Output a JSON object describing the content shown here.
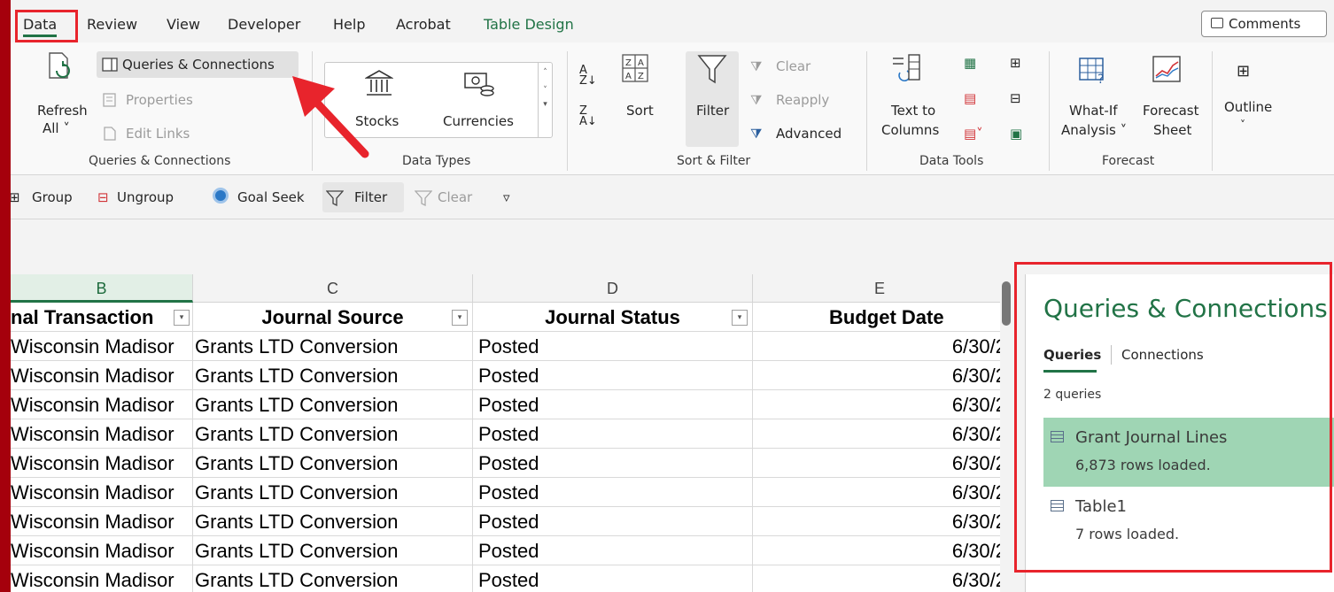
{
  "tabs": [
    {
      "label": "Data"
    },
    {
      "label": "Review"
    },
    {
      "label": "View"
    },
    {
      "label": "Developer"
    },
    {
      "label": "Help"
    },
    {
      "label": "Acrobat"
    },
    {
      "label": "Table Design"
    }
  ],
  "comments_label": "Comments",
  "ribbon": {
    "refresh_label1": "Refresh",
    "refresh_label2": "All ˅",
    "queries_connections": "Queries & Connections",
    "properties": "Properties",
    "edit_links": "Edit Links",
    "group_queries": "Queries & Connections",
    "stocks": "Stocks",
    "currencies": "Currencies",
    "group_datatypes": "Data Types",
    "sort": "Sort",
    "filter": "Filter",
    "clear": "Clear",
    "reapply": "Reapply",
    "advanced": "Advanced",
    "group_sortfilter": "Sort & Filter",
    "text_to1": "Text to",
    "text_to2": "Columns",
    "group_datatools": "Data Tools",
    "whatif1": "What-If",
    "whatif2": "Analysis ˅",
    "forecast1": "Forecast",
    "forecast2": "Sheet",
    "group_forecast": "Forecast",
    "outline": "Outline"
  },
  "qat": {
    "group": "Group",
    "ungroup": "Ungroup",
    "goal_seek": "Goal Seek",
    "filter": "Filter",
    "clear": "Clear"
  },
  "columns": [
    "B",
    "C",
    "D",
    "E"
  ],
  "headers": [
    "nal Transaction",
    "Journal Source",
    "Journal Status",
    "Budget Date"
  ],
  "rows": [
    [
      "Wisconsin Madisor",
      "Grants LTD Conversion",
      "Posted",
      "6/30/2"
    ],
    [
      "Wisconsin Madisor",
      "Grants LTD Conversion",
      "Posted",
      "6/30/2"
    ],
    [
      "Wisconsin Madisor",
      "Grants LTD Conversion",
      "Posted",
      "6/30/2"
    ],
    [
      "Wisconsin Madisor",
      "Grants LTD Conversion",
      "Posted",
      "6/30/2"
    ],
    [
      "Wisconsin Madisor",
      "Grants LTD Conversion",
      "Posted",
      "6/30/2"
    ],
    [
      "Wisconsin Madisor",
      "Grants LTD Conversion",
      "Posted",
      "6/30/2"
    ],
    [
      "Wisconsin Madisor",
      "Grants LTD Conversion",
      "Posted",
      "6/30/2"
    ],
    [
      "Wisconsin Madisor",
      "Grants LTD Conversion",
      "Posted",
      "6/30/2"
    ],
    [
      "Wisconsin Madisor",
      "Grants LTD Conversion",
      "Posted",
      "6/30/2"
    ]
  ],
  "pane": {
    "title": "Queries & Connections",
    "tab_queries": "Queries",
    "tab_connections": "Connections",
    "count": "2 queries",
    "items": [
      {
        "name": "Grant Journal Lines",
        "status": "6,873 rows loaded."
      },
      {
        "name": "Table1",
        "status": "7 rows loaded."
      }
    ]
  },
  "colors": {
    "accent": "#217346",
    "annotation": "#e8242c",
    "background": "#a5000c"
  }
}
